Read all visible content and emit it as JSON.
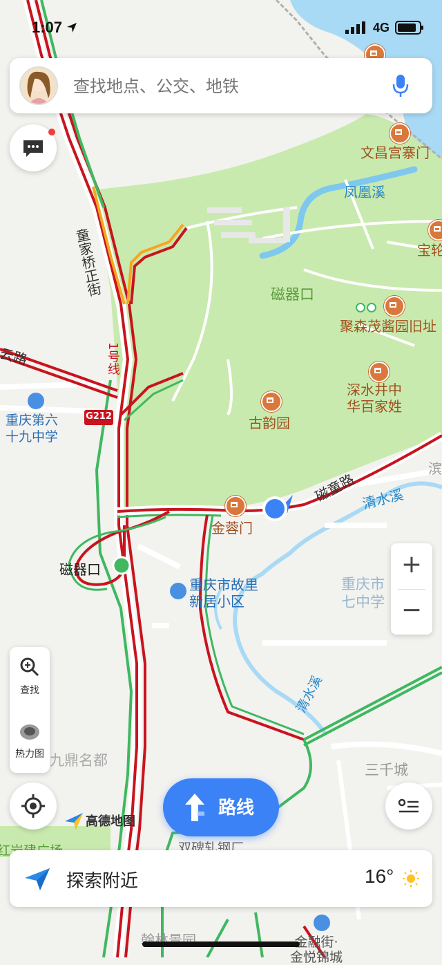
{
  "status_bar": {
    "time": "1:07",
    "network": "4G"
  },
  "search": {
    "placeholder": "查找地点、公交、地铁"
  },
  "map_labels": {
    "tongjiaqiao_street": "童家桥正街",
    "line1": "1号线",
    "g212": "G212",
    "yun_road": "云路",
    "school_69": "重庆第六\n十九中学",
    "ciqikou_station": "磁器口",
    "wenchang_gate": "文昌宫寨门",
    "fenghuang_xi": "凤凰溪",
    "ciqikou_park": "磁器口",
    "bao_lun": "宝轮",
    "jusenmao": "聚森茂酱园旧址",
    "shenshuijing": "深水井中\n华百家姓",
    "guyun_garden": "古韵园",
    "jinrong_gate": "金蓉门",
    "citong_road": "磁童路",
    "qingshui_xi_top": "清水溪",
    "bin": "滨",
    "guli": "重庆市故里\n新居小区",
    "school_7": "重庆市\n七中学",
    "qingshui_xi_bottom": "清水溪",
    "jiuding": "九鼎名都",
    "sanqian": "三千城",
    "shuangbei": "双碑轧钢厂",
    "hanlin": "翰林景园",
    "jinrong_street": "金融街·\n金悦锦城",
    "gaode_logo": "高德地图",
    "hongyan": "红岩建广场"
  },
  "tools": {
    "search_label": "查找",
    "heatmap_label": "热力图"
  },
  "zoom": {
    "in": "+",
    "out": "−"
  },
  "route_button": {
    "label": "路线"
  },
  "bottom_bar": {
    "label": "探索附近",
    "temperature": "16°"
  },
  "colors": {
    "park": "#c9eaae",
    "water": "#7ec8f0",
    "road_jam": "#c8141e",
    "road_slow": "#f5a623",
    "road_clear": "#3fb860",
    "accent_blue": "#3b82f6",
    "poi": "#d9783a"
  }
}
